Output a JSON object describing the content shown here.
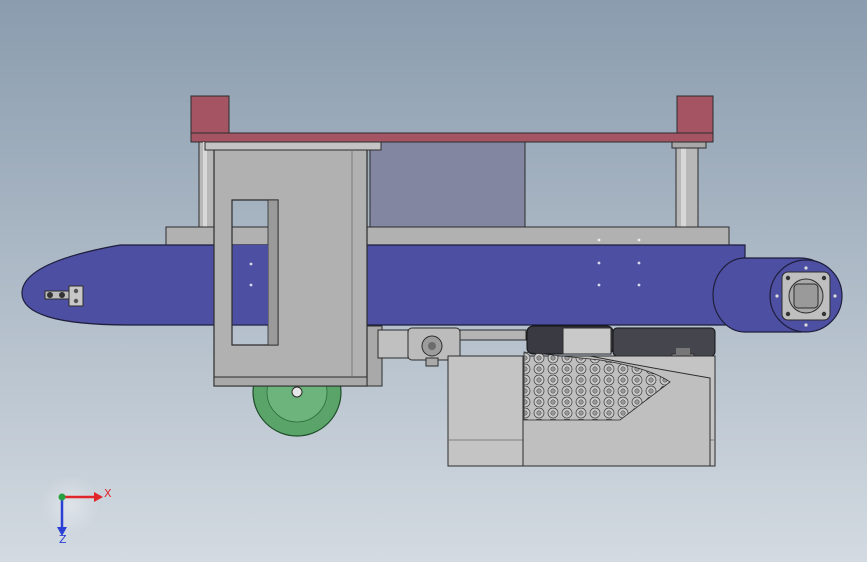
{
  "colors": {
    "bg_top": "#8a9cae",
    "bg_bottom": "#d3dae1",
    "belt_blue": "#4d4fa2",
    "plate_red": "#a45462",
    "frame_grey": "#b1b1b1",
    "cover_grey": "#8286a0",
    "wheel_green": "#5aa46a",
    "axis_x": "#e0262b",
    "axis_y": "#26a141",
    "axis_z": "#2a3fd6"
  },
  "triad": {
    "x_label": "X",
    "z_label": "Z"
  }
}
